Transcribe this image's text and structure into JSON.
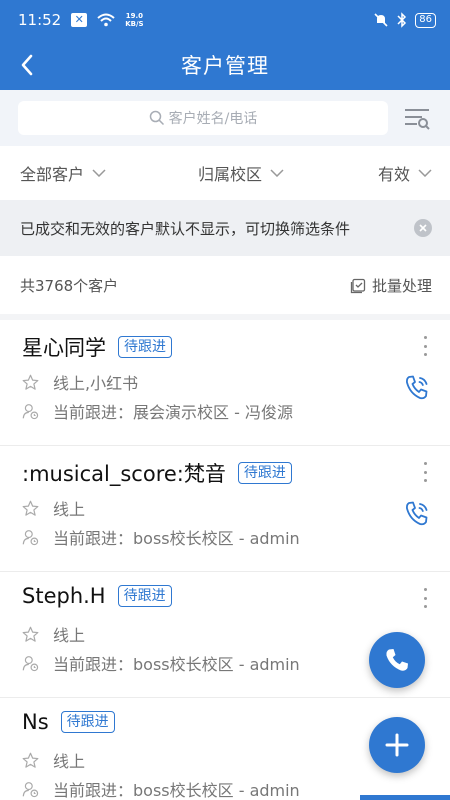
{
  "status_bar": {
    "time": "11:52",
    "net_speed_top": "19.0",
    "net_speed_bottom": "KB/S",
    "battery": "86"
  },
  "header": {
    "title": "客户管理"
  },
  "search": {
    "placeholder": "客户姓名/电话"
  },
  "filters": [
    {
      "label": "全部客户"
    },
    {
      "label": "归属校区"
    },
    {
      "label": "有效"
    }
  ],
  "notice": {
    "text": "已成交和无效的客户默认不显示，可切换筛选条件"
  },
  "summary": {
    "count_text": "共3768个客户",
    "batch_label": "批量处理"
  },
  "customers": [
    {
      "name": "星心同学",
      "status": "待跟进",
      "source": "线上,小红书",
      "follow": "当前跟进：展会演示校区 - 冯俊源"
    },
    {
      "name": ":musical_score:梵音",
      "status": "待跟进",
      "source": "线上",
      "follow": "当前跟进：boss校长校区 - admin"
    },
    {
      "name": "Steph.H",
      "status": "待跟进",
      "source": "线上",
      "follow": "当前跟进：boss校长校区 - admin"
    },
    {
      "name": "Ns",
      "status": "待跟进",
      "source": "线上",
      "follow": "当前跟进：boss校长校区 - admin"
    }
  ],
  "colors": {
    "primary": "#2f78d1",
    "badge": "#2f78d1",
    "notice_bg": "#eef0f3"
  }
}
